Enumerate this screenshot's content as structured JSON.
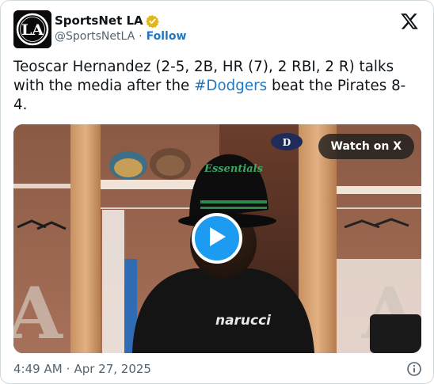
{
  "account": {
    "display_name": "SportsNet LA",
    "handle": "@SportsNetLA",
    "separator": "·",
    "follow_label": "Follow"
  },
  "tweet": {
    "text_before": "Teoscar Hernandez (2-5, 2B, HR (7), 2 RBI, 2 R) talks with the media after the ",
    "hashtag": "#Dodgers",
    "text_after": " beat the Pirates 8-4."
  },
  "media": {
    "watch_label": "Watch on X",
    "hat_text": "Essentials",
    "shirt_text": "narucci"
  },
  "footer": {
    "time": "4:49 AM",
    "separator": "·",
    "date": "Apr 27, 2025"
  },
  "icons": {
    "verified": "verified-badge-icon",
    "x_logo": "x-logo-icon",
    "play": "play-icon",
    "info": "info-icon"
  },
  "colors": {
    "accent": "#1d9bf0",
    "link": "#1d77c2",
    "verified_gold": "#e2b719",
    "text": "#0f1419",
    "muted": "#536471"
  }
}
